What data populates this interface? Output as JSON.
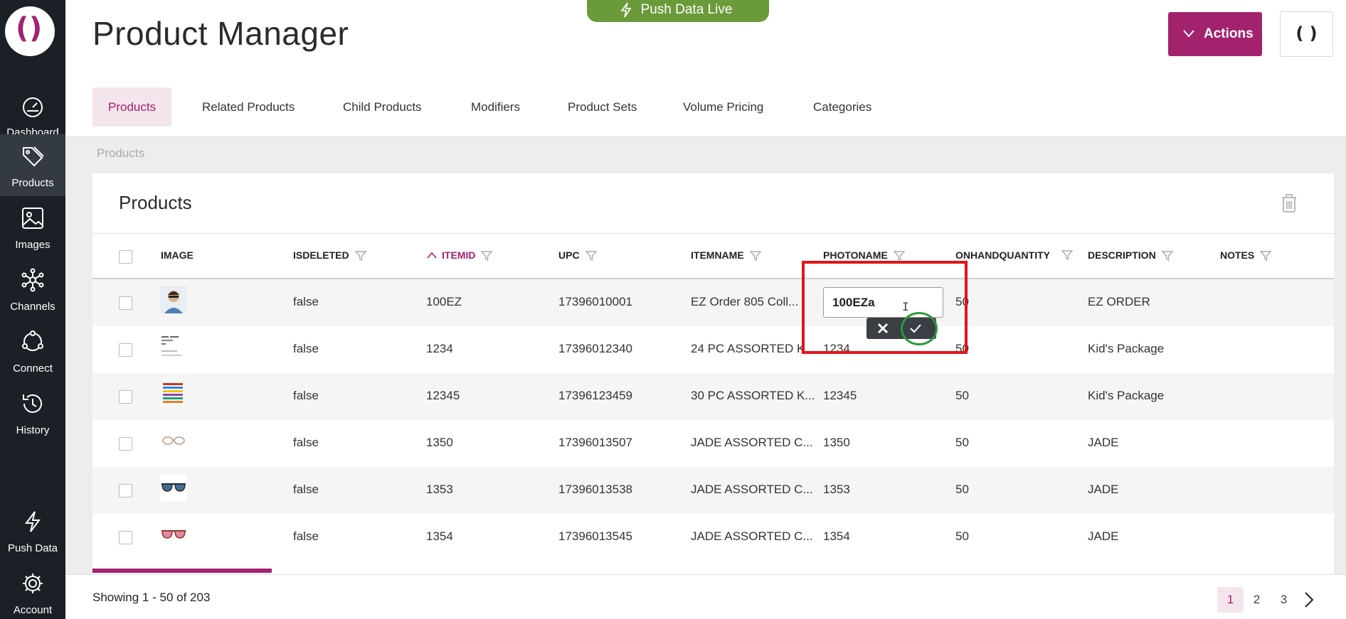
{
  "app": {
    "logo_left": "(",
    "logo_right": ")"
  },
  "sidebar": {
    "items": [
      {
        "label": "Dashboard",
        "icon": "gauge-icon"
      },
      {
        "label": "Products",
        "icon": "tags-icon"
      },
      {
        "label": "Images",
        "icon": "image-icon"
      },
      {
        "label": "Channels",
        "icon": "network-icon"
      },
      {
        "label": "Connect",
        "icon": "cycle-icon"
      },
      {
        "label": "History",
        "icon": "history-icon"
      },
      {
        "label": "Push Data",
        "icon": "lightning-icon"
      },
      {
        "label": "Account",
        "icon": "gear-icon"
      }
    ]
  },
  "header": {
    "title": "Product Manager",
    "push_live_label": "Push Data Live",
    "actions_label": "Actions",
    "icon_button": "( )"
  },
  "tabs": [
    {
      "label": "Products"
    },
    {
      "label": "Related Products"
    },
    {
      "label": "Child Products"
    },
    {
      "label": "Modifiers"
    },
    {
      "label": "Product Sets"
    },
    {
      "label": "Volume Pricing"
    },
    {
      "label": "Categories"
    }
  ],
  "breadcrumb": "Products",
  "card": {
    "title": "Products"
  },
  "table": {
    "columns": [
      "IMAGE",
      "ISDELETED",
      "ITEMID",
      "UPC",
      "ITEMNAME",
      "PHOTONAME",
      "ONHANDQUANTITY",
      "DESCRIPTION",
      "NOTES"
    ],
    "rows": [
      {
        "isdeleted": "false",
        "itemid": "100EZ",
        "upc": "17396010001",
        "itemname": "EZ Order 805 Coll...",
        "photoname": "",
        "qty": "50",
        "description": "EZ ORDER",
        "notes": ""
      },
      {
        "isdeleted": "false",
        "itemid": "1234",
        "upc": "17396012340",
        "itemname": "24 PC ASSORTED K...",
        "photoname": "1234",
        "qty": "50",
        "description": "Kid's Package",
        "notes": ""
      },
      {
        "isdeleted": "false",
        "itemid": "12345",
        "upc": "17396123459",
        "itemname": "30 PC ASSORTED K...",
        "photoname": "12345",
        "qty": "50",
        "description": "Kid's Package",
        "notes": ""
      },
      {
        "isdeleted": "false",
        "itemid": "1350",
        "upc": "17396013507",
        "itemname": "JADE ASSORTED C...",
        "photoname": "1350",
        "qty": "50",
        "description": "JADE",
        "notes": ""
      },
      {
        "isdeleted": "false",
        "itemid": "1353",
        "upc": "17396013538",
        "itemname": "JADE ASSORTED C...",
        "photoname": "1353",
        "qty": "50",
        "description": "JADE",
        "notes": ""
      },
      {
        "isdeleted": "false",
        "itemid": "1354",
        "upc": "17396013545",
        "itemname": "JADE ASSORTED C...",
        "photoname": "1354",
        "qty": "50",
        "description": "JADE",
        "notes": ""
      }
    ]
  },
  "editor": {
    "value": "100EZa"
  },
  "footer": {
    "showing": "Showing 1 - 50 of 203",
    "pages": [
      "1",
      "2",
      "3"
    ]
  },
  "colors": {
    "brand": "#a3226e",
    "sidebar": "#1b2026",
    "push_live": "#6b9a3a",
    "highlight_box": "#e3141b",
    "highlight_ring": "#2a9a3a"
  }
}
